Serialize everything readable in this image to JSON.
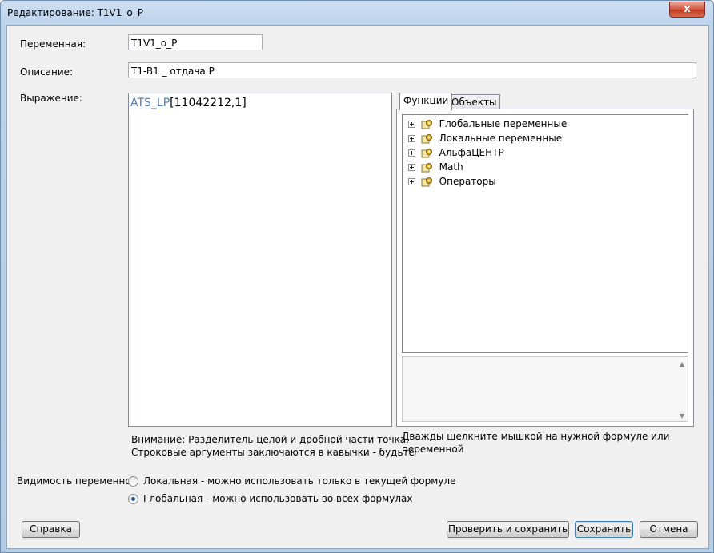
{
  "window": {
    "title": "Редактирование: T1V1_o_P",
    "close_label": "x"
  },
  "form": {
    "variable_label": "Переменная:",
    "variable_value": "T1V1_o_P",
    "description_label": "Описание:",
    "description_value": "T1-B1 _ отдача P",
    "expression_label": "Выражение:",
    "expression_function": "ATS_LP",
    "expression_args": "[11042212,1]"
  },
  "tabs": [
    {
      "label": "Функции",
      "active": true
    },
    {
      "label": "Объекты",
      "active": false
    }
  ],
  "tree": {
    "items": [
      {
        "label": "Глобальные переменные",
        "icon": "folder-gear-icon"
      },
      {
        "label": "Локальные переменные",
        "icon": "folder-gear-icon"
      },
      {
        "label": "АльфаЦЕНТР",
        "icon": "folder-gear-icon"
      },
      {
        "label": "Math",
        "icon": "folder-gear-icon"
      },
      {
        "label": "Операторы",
        "icon": "folder-gear-icon"
      }
    ]
  },
  "notes": {
    "warning_line1": "Внимание: Разделитель целой и дробной части точка.",
    "warning_line2": "Строковые аргументы заключаются в кавычки - будьте",
    "hint_line1": "Дважды щелкните мышкой на нужной формуле или",
    "hint_line2": "переменной"
  },
  "visibility": {
    "label": "Видимость переменной",
    "options": [
      {
        "label": "Локальная - можно использовать только в текущей формуле",
        "checked": false
      },
      {
        "label": "Глобальная - можно использовать во всех формулах",
        "checked": true
      }
    ]
  },
  "buttons": {
    "help": "Справка",
    "check_save": "Проверить и сохранить",
    "save": "Сохранить",
    "cancel": "Отмена"
  },
  "colors": {
    "function_name": "#4a7fb6",
    "accent": "#3c7fb1"
  }
}
